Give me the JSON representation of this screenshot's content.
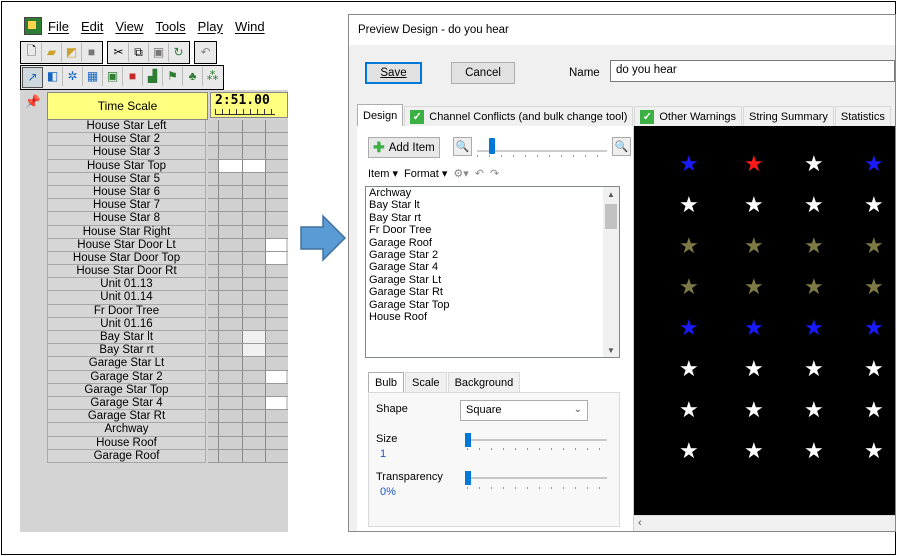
{
  "left_app": {
    "menu": [
      "File",
      "Edit",
      "View",
      "Tools",
      "Play",
      "Wind"
    ],
    "toolbar1_icons": [
      "new-file-icon",
      "open-folder-icon",
      "open-file-icon",
      "save-icon",
      "cut-icon",
      "copy-icon",
      "paste-icon",
      "refresh-icon",
      "undo-icon"
    ],
    "toolbar2_icons": [
      "pointer-icon",
      "window-icon",
      "sparkle-icon",
      "grid-icon",
      "square-icon",
      "red-square-icon",
      "bar-chart-icon",
      "flag-icon",
      "tree-icon",
      "cluster-icon"
    ],
    "time_scale_label": "Time Scale",
    "timecode": "2:51.00",
    "channels": [
      "House Star Left",
      "House Star 2",
      "House Star 3",
      "House Star Top",
      "House Star 5",
      "House Star 6",
      "House Star 7",
      "House Star 8",
      "House Star Right",
      "House Star Door Lt",
      "House Star Door Top",
      "House Star Door Rt",
      "Unit 01.13",
      "Unit 01.14",
      "Fr Door Tree",
      "Unit 01.16",
      "Bay Star lt",
      "Bay Star rt",
      "Garage Star Lt",
      "Garage Star 2",
      "Garage Star Top",
      "Garage Star 4",
      "Garage Star Rt",
      "Archway",
      "House Roof",
      "Garage Roof"
    ]
  },
  "dialog": {
    "title": "Preview Design - do you hear",
    "save_label": "Save",
    "cancel_label": "Cancel",
    "name_label": "Name",
    "name_value": "do you hear",
    "tabs": [
      "Design",
      "Channel Conflicts (and bulk change tool)",
      "Other Warnings",
      "String Summary",
      "Statistics"
    ],
    "add_item_label": "Add Item",
    "item_menu": "Item",
    "format_menu": "Format",
    "items": [
      "Archway",
      "Bay Star lt",
      "Bay Star rt",
      "Fr Door Tree",
      "Garage Roof",
      "Garage Star 2",
      "Garage Star 4",
      "Garage Star Lt",
      "Garage Star Rt",
      "Garage Star Top",
      "House Roof"
    ],
    "subtabs": [
      "Bulb",
      "Scale",
      "Background"
    ],
    "shape_label": "Shape",
    "shape_value": "Square",
    "size_label": "Size",
    "size_value": "1",
    "transparency_label": "Transparency",
    "transparency_value": "0%",
    "star_colors": [
      [
        "#1a1aff",
        "#ff1a1a",
        "#ffffff",
        "#1a1aff"
      ],
      [
        "#ffffff",
        "#ffffff",
        "#ffffff",
        "#ffffff"
      ],
      [
        "#7d7a45",
        "#7d7a45",
        "#7d7a45",
        "#7d7a45"
      ],
      [
        "#7d7a45",
        "#7d7a45",
        "#7d7a45",
        "#7d7a45"
      ],
      [
        "#1a1aff",
        "#1a1aff",
        "#1a1aff",
        "#1a1aff"
      ],
      [
        "#ffffff",
        "#ffffff",
        "#ffffff",
        "#ffffff"
      ],
      [
        "#ffffff",
        "#ffffff",
        "#ffffff",
        "#ffffff"
      ],
      [
        "#ffffff",
        "#ffffff",
        "#ffffff",
        "#ffffff"
      ]
    ]
  },
  "colors": {
    "arrow": "#5b9bd5",
    "timescale_bg": "#ffff80",
    "accent": "#0078d7"
  }
}
